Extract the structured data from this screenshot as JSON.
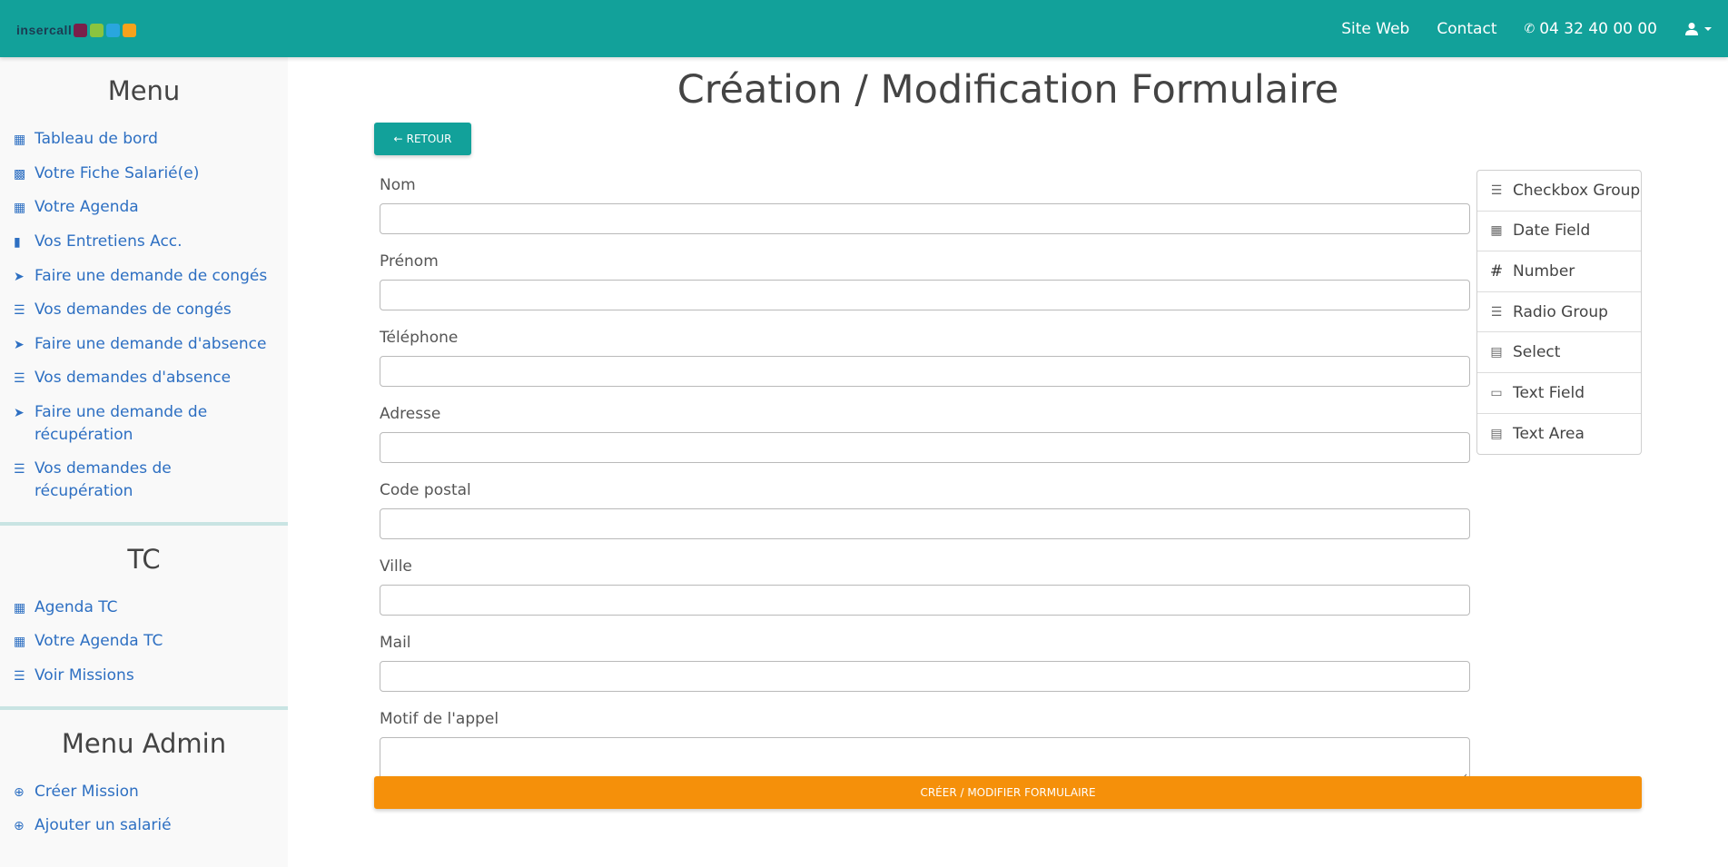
{
  "header": {
    "logo_text": "insercall",
    "nav": [
      {
        "label": "Site Web"
      },
      {
        "label": "Contact"
      },
      {
        "label": "04 32 40 00 00"
      }
    ],
    "colors": {
      "bar": "#12a19a"
    }
  },
  "sidebar": {
    "menu": {
      "title": "Menu",
      "items": [
        {
          "label": "Tableau de bord",
          "icon": "table-icon"
        },
        {
          "label": "Votre Fiche Salarié(e)",
          "icon": "id-card-icon"
        },
        {
          "label": "Votre Agenda",
          "icon": "calendar-icon"
        },
        {
          "label": "Vos Entretiens Acc.",
          "icon": "clipboard-icon"
        },
        {
          "label": "Faire une demande de congés",
          "icon": "paper-plane-icon"
        },
        {
          "label": "Vos demandes de congés",
          "icon": "list-icon"
        },
        {
          "label": "Faire une demande d'absence",
          "icon": "paper-plane-icon"
        },
        {
          "label": "Vos demandes d'absence",
          "icon": "list-icon"
        },
        {
          "label": "Faire une demande de récupération",
          "icon": "paper-plane-icon"
        },
        {
          "label": "Vos demandes de récupération",
          "icon": "list-icon"
        }
      ]
    },
    "tc": {
      "title": "TC",
      "items": [
        {
          "label": "Agenda TC",
          "icon": "calendar-icon"
        },
        {
          "label": "Votre Agenda TC",
          "icon": "calendar-icon"
        },
        {
          "label": "Voir Missions",
          "icon": "list-icon"
        }
      ]
    },
    "admin": {
      "title": "Menu Admin",
      "items": [
        {
          "label": "Créer Mission",
          "icon": "plus-circle-icon"
        },
        {
          "label": "Ajouter un salarié",
          "icon": "plus-circle-icon"
        }
      ]
    }
  },
  "main": {
    "title": "Création / Modification Formulaire",
    "back_label": "RETOUR",
    "fields": [
      {
        "label": "Nom"
      },
      {
        "label": "Prénom"
      },
      {
        "label": "Téléphone"
      },
      {
        "label": "Adresse"
      },
      {
        "label": "Code postal"
      },
      {
        "label": "Ville"
      },
      {
        "label": "Mail"
      },
      {
        "label": "Motif de l'appel"
      }
    ],
    "submit_label": "CRÉER / MODIFIER FORMULAIRE",
    "colors": {
      "submit": "#f5900a",
      "back": "#12a19a"
    }
  },
  "palette": {
    "items": [
      {
        "label": "Checkbox Group",
        "icon": "checkbox-list-icon"
      },
      {
        "label": "Date Field",
        "icon": "calendar-icon"
      },
      {
        "label": "Number",
        "icon": "hash-icon"
      },
      {
        "label": "Radio Group",
        "icon": "radio-list-icon"
      },
      {
        "label": "Select",
        "icon": "select-icon"
      },
      {
        "label": "Text Field",
        "icon": "text-field-icon"
      },
      {
        "label": "Text Area",
        "icon": "text-area-icon"
      }
    ]
  }
}
